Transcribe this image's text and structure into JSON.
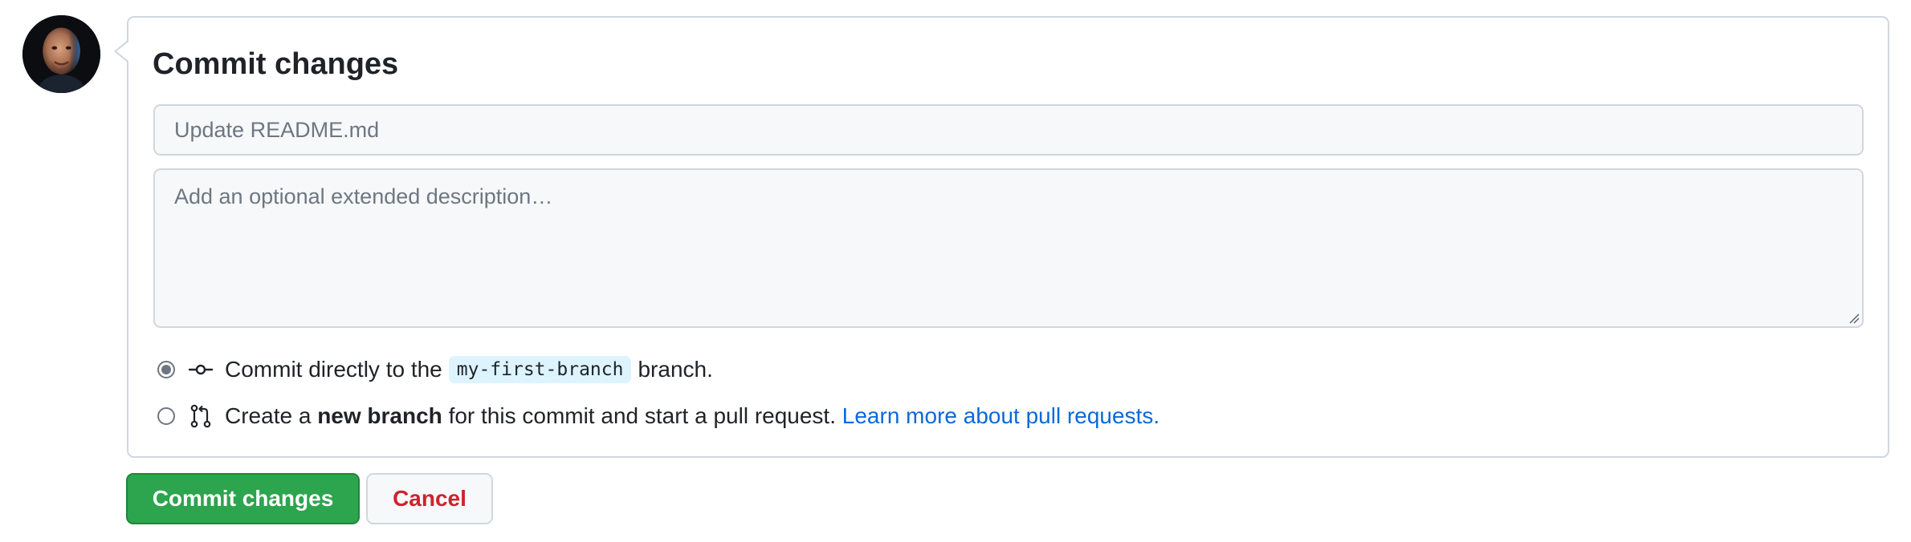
{
  "user": {
    "avatar_icon": "user-avatar-photo"
  },
  "commit_form": {
    "title": "Commit changes",
    "summary_placeholder": "Update README.md",
    "summary_value": "",
    "description_placeholder": "Add an optional extended description…",
    "description_value": "",
    "options": {
      "direct": {
        "selected": true,
        "icon": "git-commit-icon",
        "text_before": "Commit directly to the",
        "branch_name": "my-first-branch",
        "text_after": "branch."
      },
      "new_branch": {
        "selected": false,
        "icon": "git-pull-request-icon",
        "text_before": "Create a",
        "bold_text": "new branch",
        "text_after": "for this commit and start a pull request.",
        "link_text": "Learn more about pull requests."
      }
    }
  },
  "actions": {
    "commit_label": "Commit changes",
    "cancel_label": "Cancel"
  },
  "colors": {
    "primary_green": "#2da44e",
    "danger_red": "#cf222e",
    "link_blue": "#0969da",
    "branch_chip_bg": "#ddf4ff",
    "border": "#d0d7de",
    "field_bg": "#f6f8fa"
  }
}
